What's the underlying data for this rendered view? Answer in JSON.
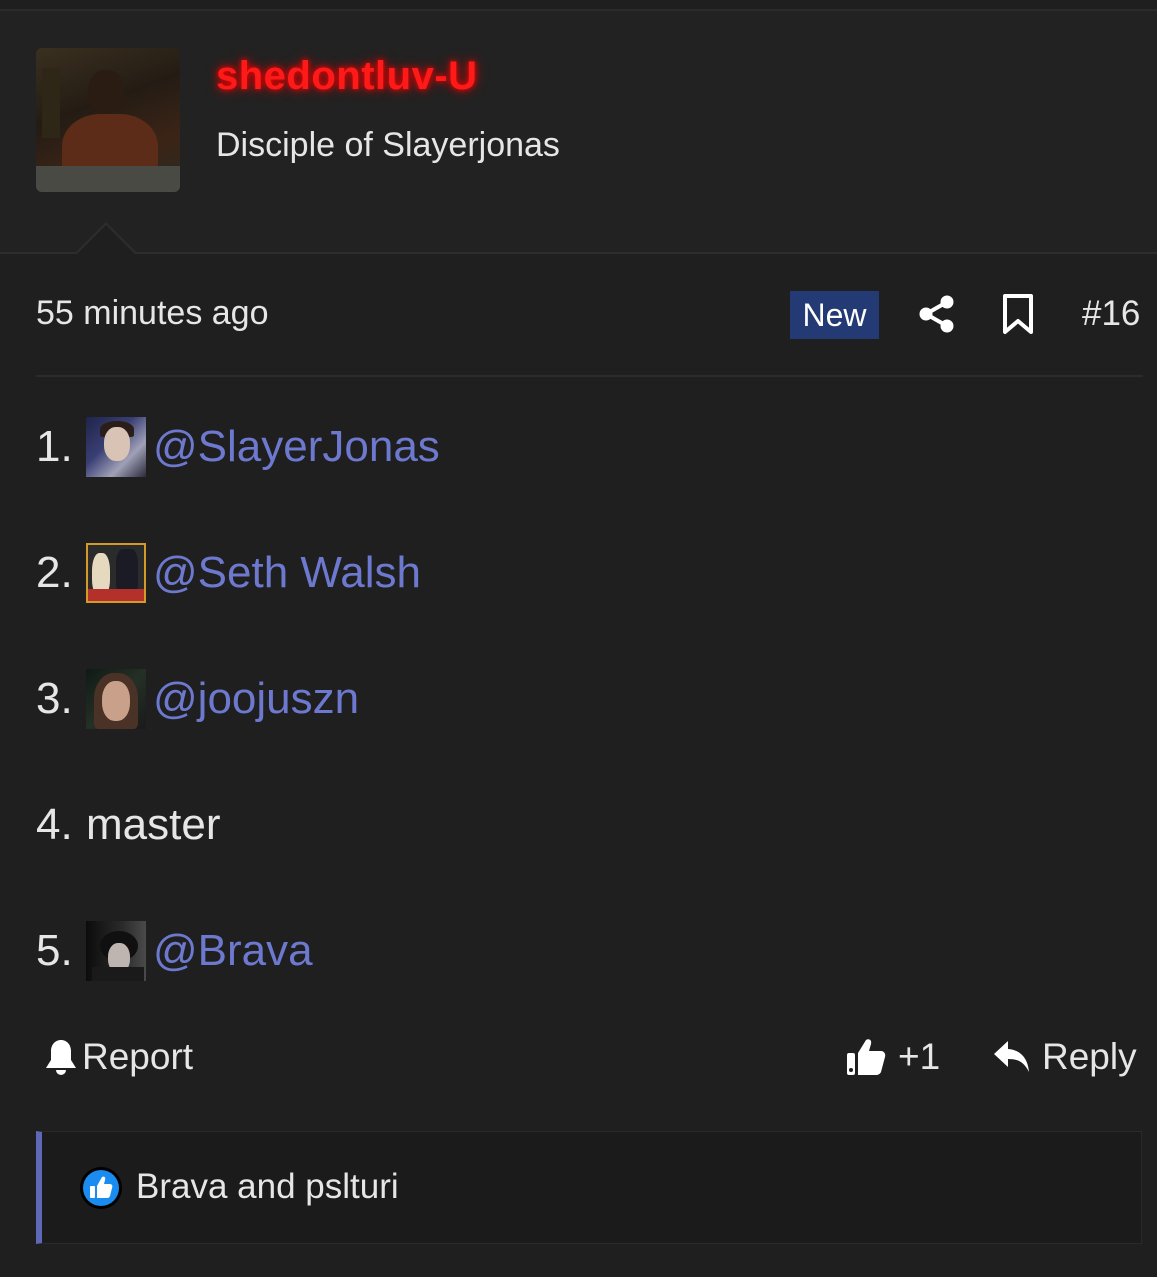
{
  "post": {
    "author": {
      "username": "shedontluv-U",
      "title": "Disciple of Slayerjonas"
    },
    "timestamp": "55 minutes ago",
    "badge": "New",
    "post_number": "#16",
    "list": [
      {
        "number": "1.",
        "text": "@SlayerJonas",
        "type": "mention"
      },
      {
        "number": "2.",
        "text": "@Seth Walsh",
        "type": "mention"
      },
      {
        "number": "3.",
        "text": "@joojuszn",
        "type": "mention"
      },
      {
        "number": "4.",
        "text": "master",
        "type": "plain"
      },
      {
        "number": "5.",
        "text": "@Brava",
        "type": "mention"
      }
    ],
    "actions": {
      "report_label": "Report",
      "like_count": "+1",
      "reply_label": "Reply"
    },
    "reactions": {
      "text": "Brava and pslturi"
    }
  },
  "colors": {
    "background": "#1f1f1f",
    "username": "#ff1a1a",
    "mention": "#6d79cf",
    "badge_bg": "#233a74",
    "reaction_accent": "#5d68b6",
    "like_blue": "#1a8cf0"
  },
  "icons": {
    "share": "share-icon",
    "bookmark": "bookmark-icon",
    "report": "bell-icon",
    "like": "thumbs-up-icon",
    "reply": "reply-arrow-icon",
    "reaction": "like-reaction-icon"
  }
}
